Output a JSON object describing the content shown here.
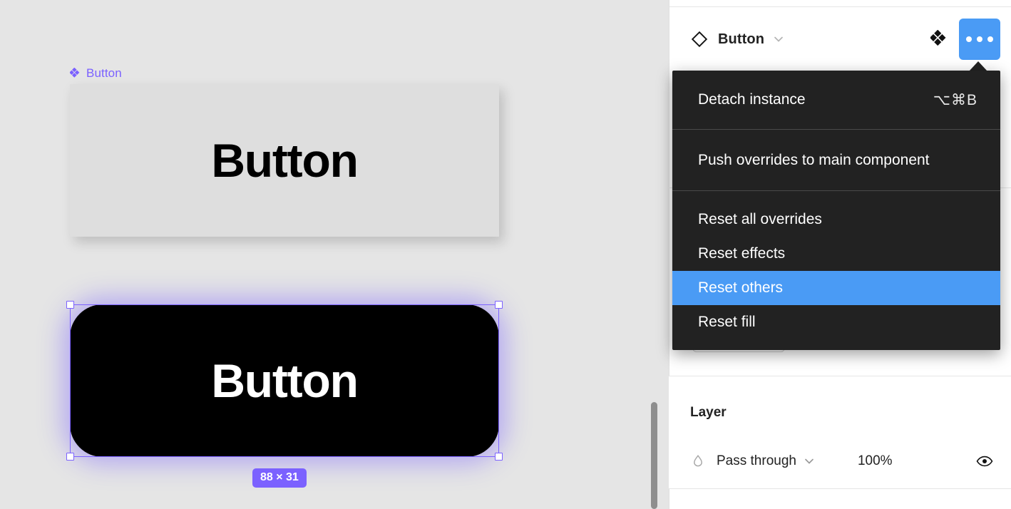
{
  "canvas": {
    "component_label": "Button",
    "component_icon": "component-diamond-icon",
    "gray_button_label": "Button",
    "black_button_label": "Button",
    "size_badge": "88 × 31",
    "accent_color": "#7B61FF"
  },
  "panel": {
    "instance": {
      "icon": "instance-diamond-icon",
      "name": "Button",
      "chevron_icon": "chevron-down-icon",
      "swap_icon": "swap-instance-icon",
      "more_icon": "more-options-icon"
    },
    "layer": {
      "title": "Layer",
      "blend_icon": "blend-mode-icon",
      "blend_mode": "Pass through",
      "blend_chevron_icon": "chevron-down-icon",
      "opacity": "100%",
      "visibility_icon": "eye-icon"
    }
  },
  "context_menu": {
    "accent_color": "#4A9BF5",
    "background": "#222222",
    "sections": [
      {
        "items": [
          {
            "label": "Detach instance",
            "shortcut": "⌥⌘B",
            "selected": false
          }
        ]
      },
      {
        "items": [
          {
            "label": "Push overrides to main component",
            "shortcut": "",
            "selected": false
          }
        ]
      },
      {
        "items": [
          {
            "label": "Reset all overrides",
            "shortcut": "",
            "selected": false
          },
          {
            "label": "Reset effects",
            "shortcut": "",
            "selected": false
          },
          {
            "label": "Reset others",
            "shortcut": "",
            "selected": true
          },
          {
            "label": "Reset fill",
            "shortcut": "",
            "selected": false
          }
        ]
      }
    ]
  }
}
